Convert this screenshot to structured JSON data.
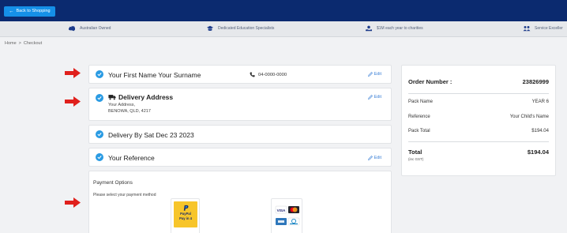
{
  "topbar": {
    "back_label": "Back to Shopping"
  },
  "infobar": {
    "items": [
      {
        "label": "Australian Owned",
        "icon": "australia-map-icon"
      },
      {
        "label": "Dedicated Education Specialists",
        "icon": "graduation-cap-icon"
      },
      {
        "label": "$1M each year to charities",
        "icon": "charity-hand-icon"
      },
      {
        "label": "Service Exceller",
        "icon": "people-icon"
      }
    ]
  },
  "breadcrumb": {
    "home": "Home",
    "separator": ">",
    "current": "Checkout"
  },
  "checkout": {
    "name": {
      "title": "Your First Name  Your Surname",
      "phone": "04-0000-0000",
      "edit": "Edit"
    },
    "delivery": {
      "title": "Delivery Address",
      "lines": [
        "Your Address,",
        "BENOWA, QLD, 4217"
      ],
      "edit": "Edit"
    },
    "delivery_by": {
      "title": "Delivery By Sat Dec 23 2023"
    },
    "reference": {
      "title": "Your Reference",
      "edit": "Edit"
    },
    "payment": {
      "title": "Payment Options",
      "subtitle": "Please select your payment method",
      "paypal_lines": [
        "PayPal",
        "Pay in 4"
      ]
    }
  },
  "summary": {
    "order_number_label": "Order Number :",
    "order_number": "23826999",
    "rows": [
      {
        "label": "Pack Name",
        "value": "YEAR 6"
      },
      {
        "label": "Reference",
        "value": "Your Child's Name"
      },
      {
        "label": "Pack Total",
        "value": "$194.04"
      }
    ],
    "total_label": "Total",
    "total_sub": "(inc GST)",
    "total_value": "$194.04"
  },
  "colors": {
    "topbar": "#0b2a6f",
    "back_button": "#1590e8",
    "check": "#2a9be3",
    "annotation_arrow": "#e0201c",
    "paypal": "#f7c52a"
  }
}
